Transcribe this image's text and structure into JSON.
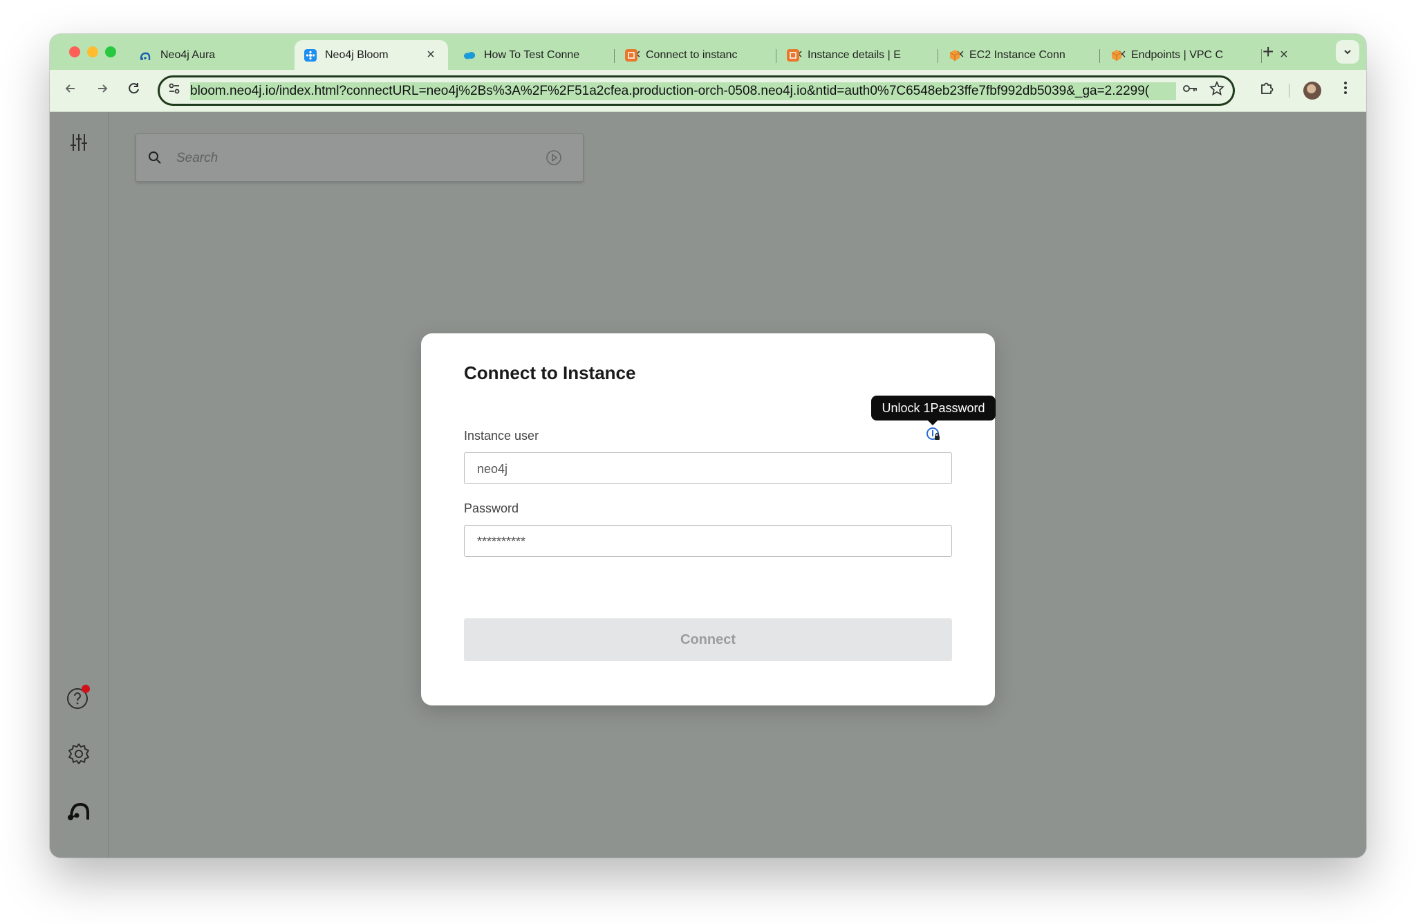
{
  "browser": {
    "tabs": [
      {
        "label": "Neo4j Aura",
        "close": "×"
      },
      {
        "label": "Neo4j Bloom",
        "close": "×"
      },
      {
        "label": "How To Test Conne",
        "close": "×"
      },
      {
        "label": "Connect to instanc",
        "close": "×"
      },
      {
        "label": "Instance details | E",
        "close": "×"
      },
      {
        "label": "EC2 Instance Conn",
        "close": "×"
      },
      {
        "label": "Endpoints | VPC C",
        "close": "×"
      }
    ],
    "new_tab": "+",
    "url": "bloom.neo4j.io/index.html?connectURL=neo4j%2Bs%3A%2F%2F51a2cfea.production-orch-0508.neo4j.io&ntid=auth0%7C6548eb23ffe7fbf992db5039&_ga=2.2299(",
    "colors": {
      "tab_strip": "#b9e2b3",
      "toolbar": "#e9f4e5"
    }
  },
  "app": {
    "search": {
      "placeholder": "Search"
    }
  },
  "dialog": {
    "title": "Connect to Instance",
    "user_label": "Instance user",
    "user_value": "neo4j",
    "password_label": "Password",
    "password_value": "**********",
    "connect_label": "Connect"
  },
  "tooltip": {
    "text": "Unlock 1Password"
  }
}
